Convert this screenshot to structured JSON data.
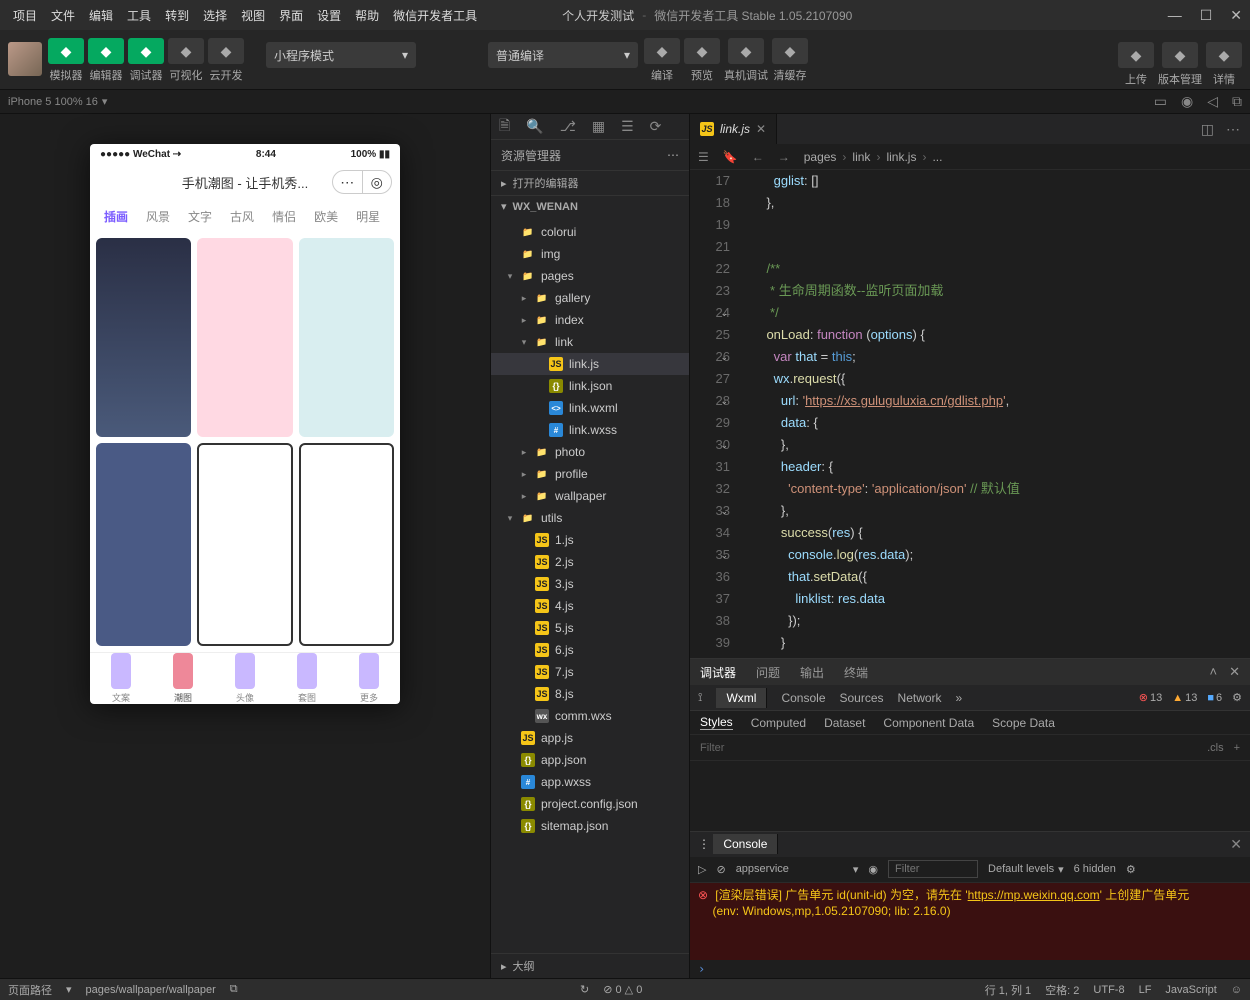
{
  "menu": {
    "items": [
      "项目",
      "文件",
      "编辑",
      "工具",
      "转到",
      "选择",
      "视图",
      "界面",
      "设置",
      "帮助",
      "微信开发者工具"
    ]
  },
  "title": {
    "project": "个人开发测试",
    "app": "微信开发者工具 Stable 1.05.2107090"
  },
  "toolbar": {
    "left": [
      {
        "l": "模拟器"
      },
      {
        "l": "编辑器"
      },
      {
        "l": "调试器"
      },
      {
        "l": "可视化"
      },
      {
        "l": "云开发"
      }
    ],
    "mode": "小程序模式",
    "compile": "普通编译",
    "mid": [
      {
        "l": "编译"
      },
      {
        "l": "预览"
      },
      {
        "l": "真机调试"
      },
      {
        "l": "清缓存"
      }
    ],
    "right": [
      {
        "l": "上传"
      },
      {
        "l": "版本管理"
      },
      {
        "l": "详情"
      }
    ]
  },
  "device": "iPhone 5 100% 16",
  "explorer": {
    "title": "资源管理器",
    "open": "打开的编辑器",
    "project": "WX_WENAN",
    "outline": "大纲",
    "tree": [
      {
        "d": 0,
        "a": "",
        "t": "folder",
        "n": "colorui"
      },
      {
        "d": 0,
        "a": "",
        "t": "pages",
        "n": "img"
      },
      {
        "d": 0,
        "a": "▾",
        "t": "pages",
        "n": "pages"
      },
      {
        "d": 1,
        "a": "▸",
        "t": "folder",
        "n": "gallery"
      },
      {
        "d": 1,
        "a": "▸",
        "t": "folder",
        "n": "index"
      },
      {
        "d": 1,
        "a": "▾",
        "t": "folder",
        "n": "link"
      },
      {
        "d": 2,
        "a": "",
        "t": "js",
        "n": "link.js",
        "sel": true
      },
      {
        "d": 2,
        "a": "",
        "t": "json",
        "n": "link.json"
      },
      {
        "d": 2,
        "a": "",
        "t": "wxml",
        "n": "link.wxml"
      },
      {
        "d": 2,
        "a": "",
        "t": "wxss",
        "n": "link.wxss"
      },
      {
        "d": 1,
        "a": "▸",
        "t": "folder",
        "n": "photo"
      },
      {
        "d": 1,
        "a": "▸",
        "t": "folder",
        "n": "profile"
      },
      {
        "d": 1,
        "a": "▸",
        "t": "folder",
        "n": "wallpaper"
      },
      {
        "d": 0,
        "a": "▾",
        "t": "pages",
        "n": "utils"
      },
      {
        "d": 1,
        "a": "",
        "t": "js",
        "n": "1.js"
      },
      {
        "d": 1,
        "a": "",
        "t": "js",
        "n": "2.js"
      },
      {
        "d": 1,
        "a": "",
        "t": "js",
        "n": "3.js"
      },
      {
        "d": 1,
        "a": "",
        "t": "js",
        "n": "4.js"
      },
      {
        "d": 1,
        "a": "",
        "t": "js",
        "n": "5.js"
      },
      {
        "d": 1,
        "a": "",
        "t": "js",
        "n": "6.js"
      },
      {
        "d": 1,
        "a": "",
        "t": "js",
        "n": "7.js"
      },
      {
        "d": 1,
        "a": "",
        "t": "js",
        "n": "8.js"
      },
      {
        "d": 1,
        "a": "",
        "t": "wxs",
        "n": "comm.wxs"
      },
      {
        "d": 0,
        "a": "",
        "t": "js",
        "n": "app.js"
      },
      {
        "d": 0,
        "a": "",
        "t": "json",
        "n": "app.json"
      },
      {
        "d": 0,
        "a": "",
        "t": "wxss",
        "n": "app.wxss"
      },
      {
        "d": 0,
        "a": "",
        "t": "json",
        "n": "project.config.json"
      },
      {
        "d": 0,
        "a": "",
        "t": "json",
        "n": "sitemap.json"
      }
    ]
  },
  "editor": {
    "tab": "link.js",
    "crumbs": [
      "pages",
      "link",
      "link.js",
      "..."
    ],
    "lines": [
      {
        "n": 17,
        "h": "      <span class='c-prop'>gglist</span>: []"
      },
      {
        "n": 18,
        "h": "    },"
      },
      {
        "n": 19,
        "h": ""
      },
      {
        "n": "",
        "h": ""
      },
      {
        "n": 21,
        "h": "    <span class='c-cmt'>/**</span>"
      },
      {
        "n": 22,
        "h": "<span class='c-cmt'>     * 生命周期函数--监听页面加载</span>"
      },
      {
        "n": 23,
        "h": "<span class='c-cmt'>     */</span>"
      },
      {
        "n": 24,
        "h": "    <span class='c-fn'>onLoad</span>: <span class='c-kw'>function</span> (<span class='c-var'>options</span>) {",
        "fold": true
      },
      {
        "n": 25,
        "h": "      <span class='c-kw'>var</span> <span class='c-var'>that</span> = <span class='c-this'>this</span>;"
      },
      {
        "n": 26,
        "h": "      <span class='c-var'>wx</span>.<span class='c-fn'>request</span>({",
        "fold": true
      },
      {
        "n": 27,
        "h": "        <span class='c-prop'>url</span>: <span class='c-str'>'</span><span class='c-link'>https://xs.guluguluxia.cn/gdlist.php</span><span class='c-str'>'</span>,"
      },
      {
        "n": 28,
        "h": "        <span class='c-prop'>data</span>: {",
        "fold": true
      },
      {
        "n": 29,
        "h": "        },"
      },
      {
        "n": 30,
        "h": "        <span class='c-prop'>header</span>: {",
        "fold": true
      },
      {
        "n": 31,
        "h": "          <span class='c-str'>'content-type'</span>: <span class='c-str'>'application/json'</span> <span class='c-cmt'>// 默认值</span>"
      },
      {
        "n": 32,
        "h": "        },"
      },
      {
        "n": 33,
        "h": "        <span class='c-fn'>success</span>(<span class='c-var'>res</span>) {",
        "fold": true
      },
      {
        "n": 34,
        "h": "          <span class='c-var'>console</span>.<span class='c-fn'>log</span>(<span class='c-var'>res</span>.<span class='c-prop'>data</span>);"
      },
      {
        "n": 35,
        "h": "          <span class='c-var'>that</span>.<span class='c-fn'>setData</span>({",
        "fold": true
      },
      {
        "n": 36,
        "h": "            <span class='c-prop'>linklist</span>: <span class='c-var'>res</span>.<span class='c-prop'>data</span>"
      },
      {
        "n": 37,
        "h": "          });"
      },
      {
        "n": 38,
        "h": "        }"
      },
      {
        "n": 39,
        "h": "      })"
      }
    ]
  },
  "sim": {
    "status": {
      "l": "●●●●● WeChat ⇢",
      "m": "8:44",
      "r": "100% ▮▮"
    },
    "title": "手机潮图 - 让手机秀...",
    "tabs": [
      "插画",
      "风景",
      "文字",
      "古风",
      "情侣",
      "欧美",
      "明星"
    ],
    "nav": [
      "文案",
      "潮图",
      "头像",
      "套图",
      "更多"
    ]
  },
  "debug": {
    "tabs": [
      "调试器",
      "问题",
      "输出",
      "终端"
    ],
    "devtabs": [
      "Wxml",
      "Console",
      "Sources",
      "Network"
    ],
    "badges": {
      "err": "13",
      "warn": "13",
      "info": "6"
    },
    "styles": [
      "Styles",
      "Computed",
      "Dataset",
      "Component Data",
      "Scope Data"
    ],
    "filterPh": "Filter",
    "cls": ".cls",
    "consoleLabel": "Console",
    "context": "appservice",
    "levels": "Default levels",
    "hidden": "6 hidden",
    "err1": "[渲染层错误] 广告单元 id(unit-id) 为空，请先在 '",
    "errurl": "https://mp.weixin.qq.com",
    "err1b": "' 上创建广告单元",
    "err2": "(env: Windows,mp,1.05.2107090; lib: 2.16.0)"
  },
  "status": {
    "pathLabel": "页面路径",
    "path": "pages/wallpaper/wallpaper",
    "diag": "⊘ 0 △ 0",
    "pos": "行 1, 列 1",
    "space": "空格: 2",
    "enc": "UTF-8",
    "eol": "LF",
    "lang": "JavaScript"
  }
}
